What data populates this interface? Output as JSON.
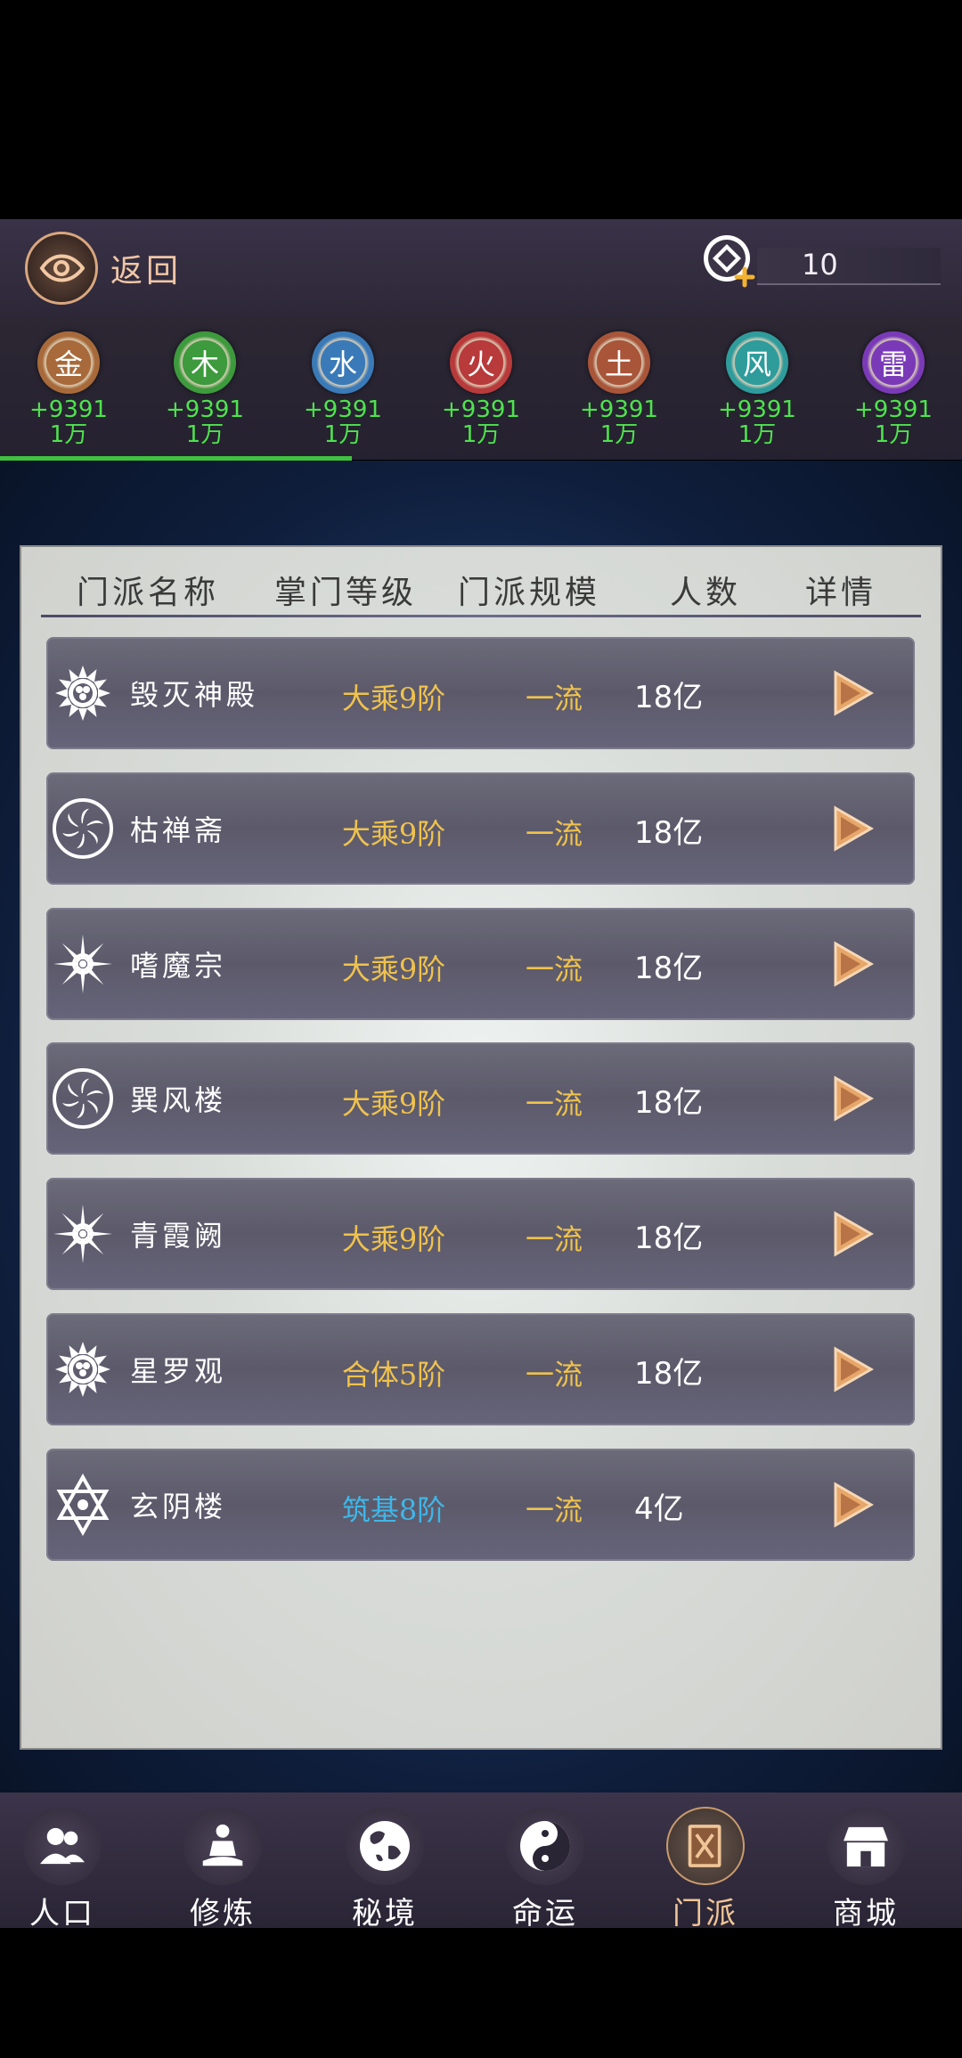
{
  "header": {
    "back_label": "返回",
    "currency_value": "10"
  },
  "elements": [
    {
      "name": "金",
      "delta": "+9391",
      "amount": "1万",
      "color": "#a86a3a"
    },
    {
      "name": "木",
      "delta": "+9391",
      "amount": "1万",
      "color": "#3d9a3d"
    },
    {
      "name": "水",
      "delta": "+9391",
      "amount": "1万",
      "color": "#3a7ab8"
    },
    {
      "name": "火",
      "delta": "+9391",
      "amount": "1万",
      "color": "#b83a3a"
    },
    {
      "name": "土",
      "delta": "+9391",
      "amount": "1万",
      "color": "#a8553a"
    },
    {
      "name": "风",
      "delta": "+9391",
      "amount": "1万",
      "color": "#2f9c9c"
    },
    {
      "name": "雷",
      "delta": "+9391",
      "amount": "1万",
      "color": "#7a3ab8"
    }
  ],
  "table": {
    "headers": [
      "门派名称",
      "掌门等级",
      "门派规模",
      "人数",
      "详情"
    ],
    "rows": [
      {
        "name": "毁灭神殿",
        "level": "大乘9阶",
        "level_color": "#f0c24d",
        "scale": "一流",
        "pop": "18亿",
        "emblem": "sun-emblem-icon"
      },
      {
        "name": "枯禅斋",
        "level": "大乘9阶",
        "level_color": "#f0c24d",
        "scale": "一流",
        "pop": "18亿",
        "emblem": "swirl-emblem-icon"
      },
      {
        "name": "嗜魔宗",
        "level": "大乘9阶",
        "level_color": "#f0c24d",
        "scale": "一流",
        "pop": "18亿",
        "emblem": "star-emblem-icon"
      },
      {
        "name": "巽风楼",
        "level": "大乘9阶",
        "level_color": "#f0c24d",
        "scale": "一流",
        "pop": "18亿",
        "emblem": "swirl-emblem-icon"
      },
      {
        "name": "青霞阙",
        "level": "大乘9阶",
        "level_color": "#f0c24d",
        "scale": "一流",
        "pop": "18亿",
        "emblem": "star-emblem-icon"
      },
      {
        "name": "星罗观",
        "level": "合体5阶",
        "level_color": "#f0c24d",
        "scale": "一流",
        "pop": "18亿",
        "emblem": "sun-emblem-icon"
      },
      {
        "name": "玄阴楼",
        "level": "筑基8阶",
        "level_color": "#3fb6e8",
        "scale": "一流",
        "pop": "4亿",
        "emblem": "hexagram-emblem-icon"
      }
    ]
  },
  "nav": [
    {
      "label": "人口",
      "icon": "people-icon",
      "active": false
    },
    {
      "label": "修炼",
      "icon": "meditate-icon",
      "active": false
    },
    {
      "label": "秘境",
      "icon": "globe-icon",
      "active": false
    },
    {
      "label": "命运",
      "icon": "yin-yang-icon",
      "active": false
    },
    {
      "label": "门派",
      "icon": "sect-book-icon",
      "active": true
    },
    {
      "label": "商城",
      "icon": "shop-icon",
      "active": false
    }
  ]
}
